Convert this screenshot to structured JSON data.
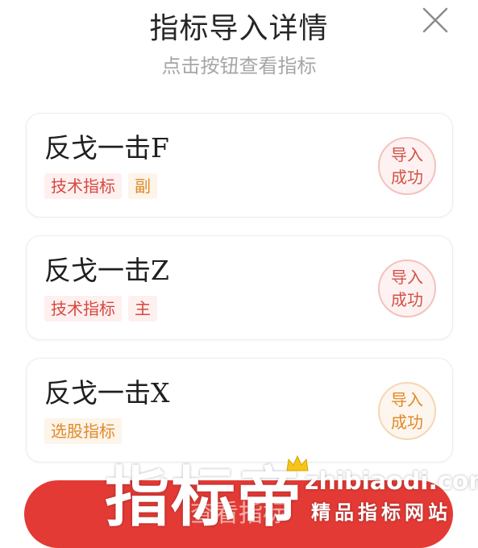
{
  "header": {
    "title": "指标导入详情",
    "subtitle": "点击按钮查看指标",
    "close_icon": "close-icon"
  },
  "cards": [
    {
      "name": "反戈一击F",
      "tags": [
        {
          "label": "技术指标",
          "color": "#d8473f"
        },
        {
          "label": "副",
          "color": "#e08a2a"
        }
      ],
      "status_line1": "导入",
      "status_line2": "成功",
      "status_color": "#d25249"
    },
    {
      "name": "反戈一击Z",
      "tags": [
        {
          "label": "技术指标",
          "color": "#d8473f"
        },
        {
          "label": "主",
          "color": "#d8473f"
        }
      ],
      "status_line1": "导入",
      "status_line2": "成功",
      "status_color": "#d25249"
    },
    {
      "name": "反戈一击X",
      "tags": [
        {
          "label": "选股指标",
          "color": "#e08a2a"
        }
      ],
      "status_line1": "导入",
      "status_line2": "成功",
      "status_color": "#e08a2a"
    }
  ],
  "bottom_button": {
    "label": "查看指标",
    "color": "#e33a35"
  },
  "watermark": {
    "brand": "指标帝",
    "url": "zhibiaodi.com",
    "tagline": "精品指标网站"
  }
}
